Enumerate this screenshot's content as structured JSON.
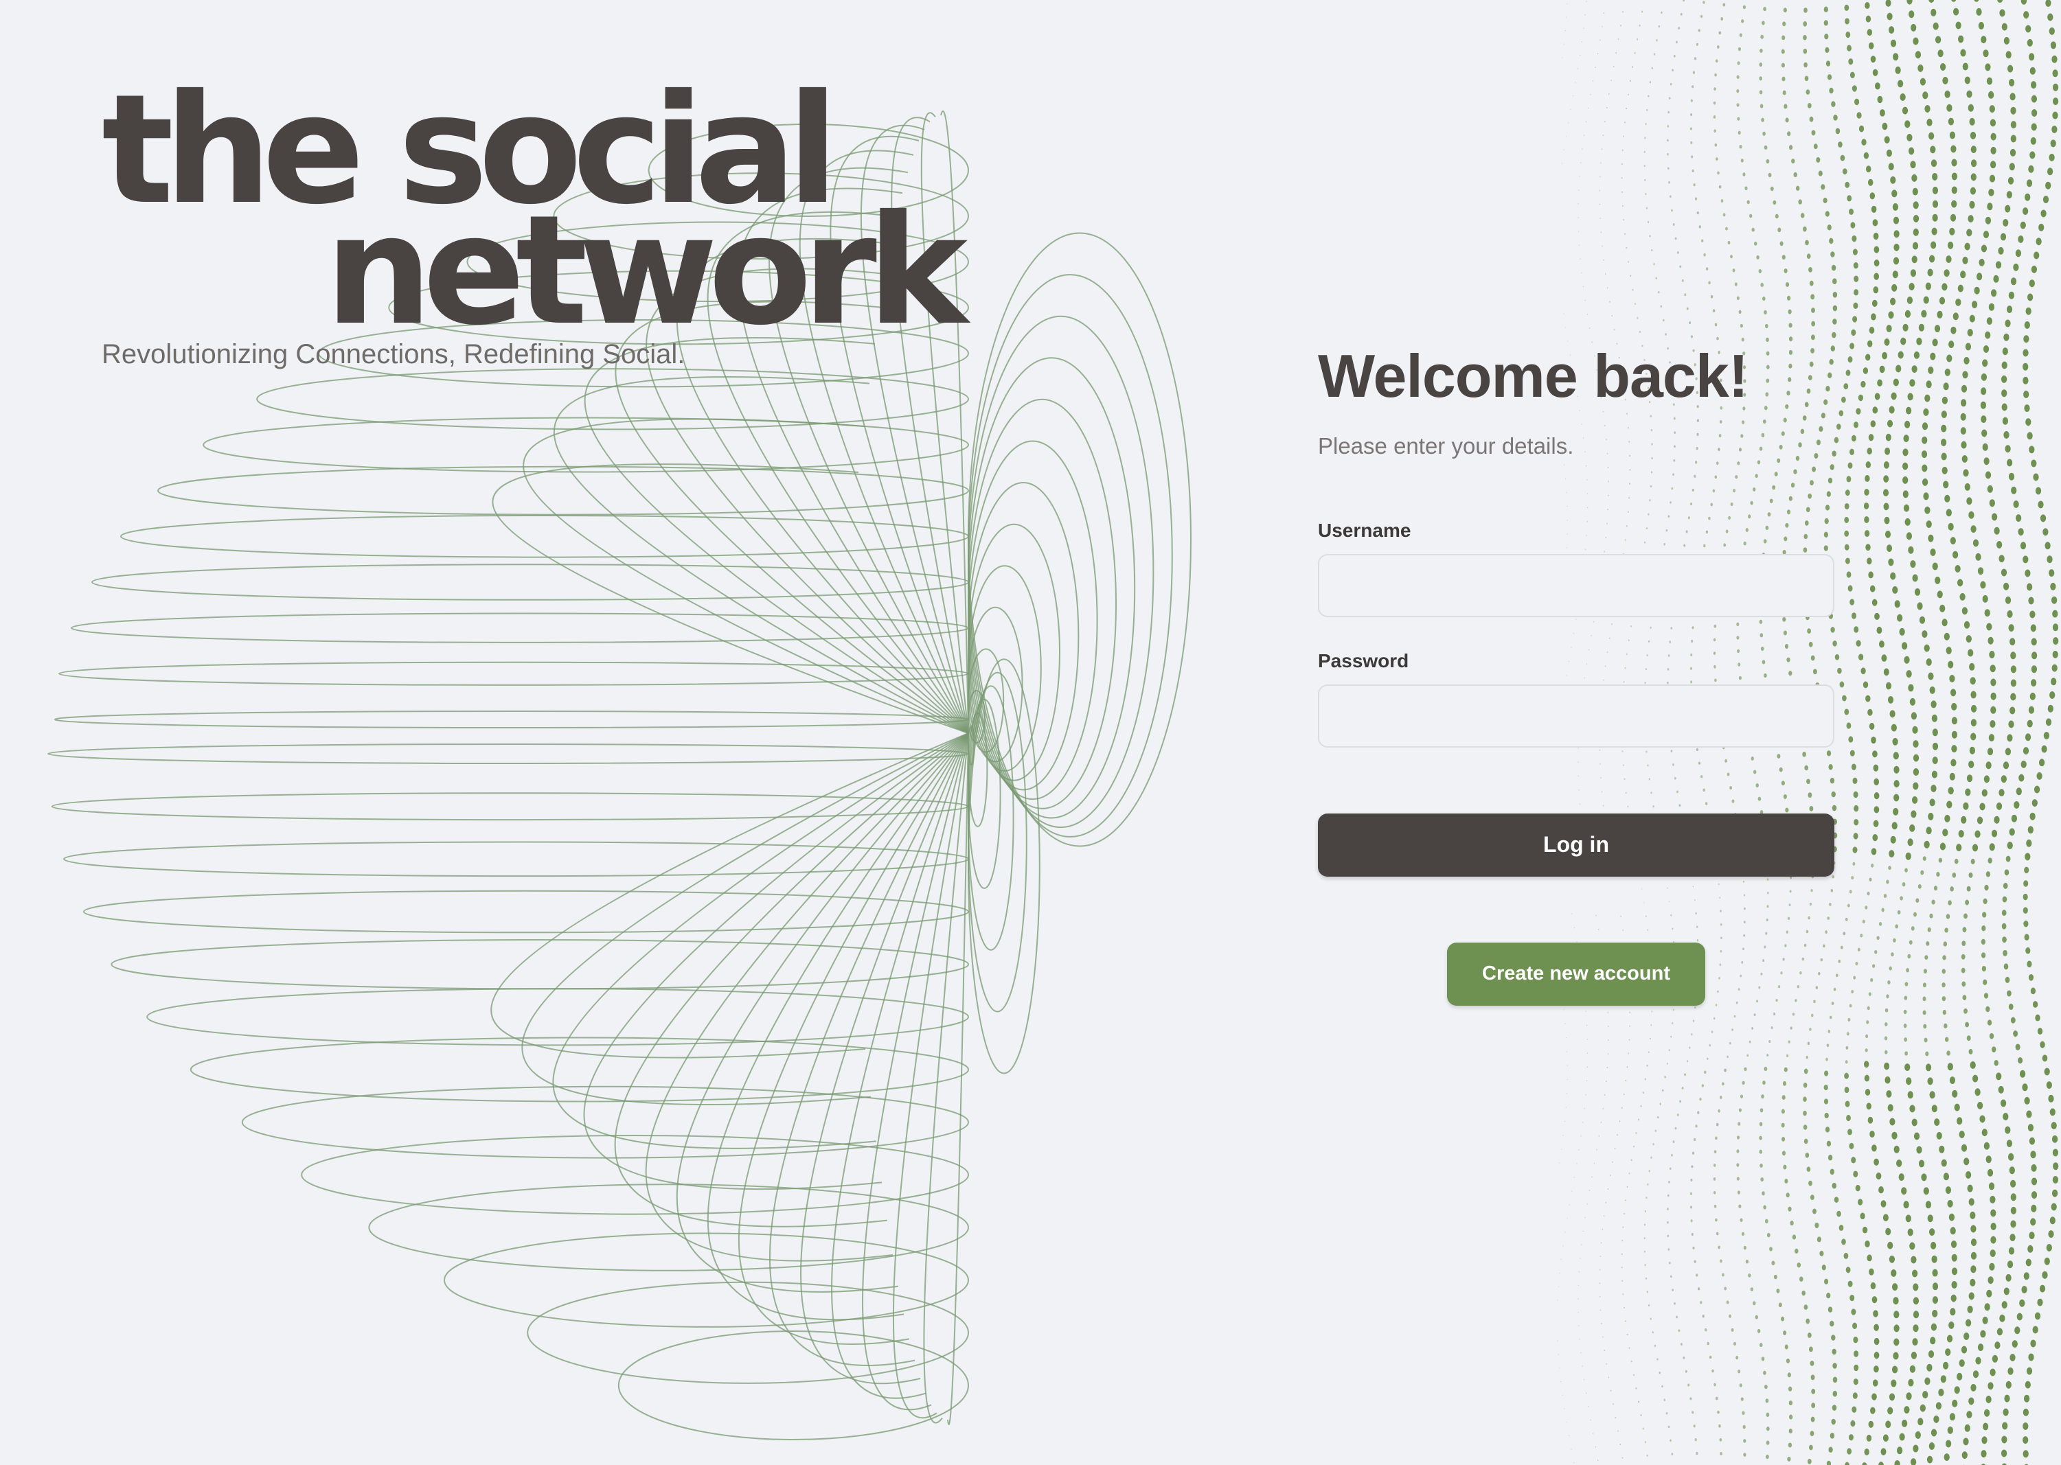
{
  "brand": {
    "line1": "the social",
    "line2": "network",
    "tagline": "Revolutionizing Connections, Redefining Social."
  },
  "login": {
    "title": "Welcome back!",
    "subtitle": "Please enter your details.",
    "username_label": "Username",
    "username_value": "",
    "password_label": "Password",
    "password_value": "",
    "login_button": "Log in",
    "create_button": "Create new account"
  },
  "theme": {
    "background": "#f0f2f5",
    "primary_dark": "#494442",
    "accent_green": "#6e9050",
    "wireframe_stroke": "#7a9a72"
  }
}
